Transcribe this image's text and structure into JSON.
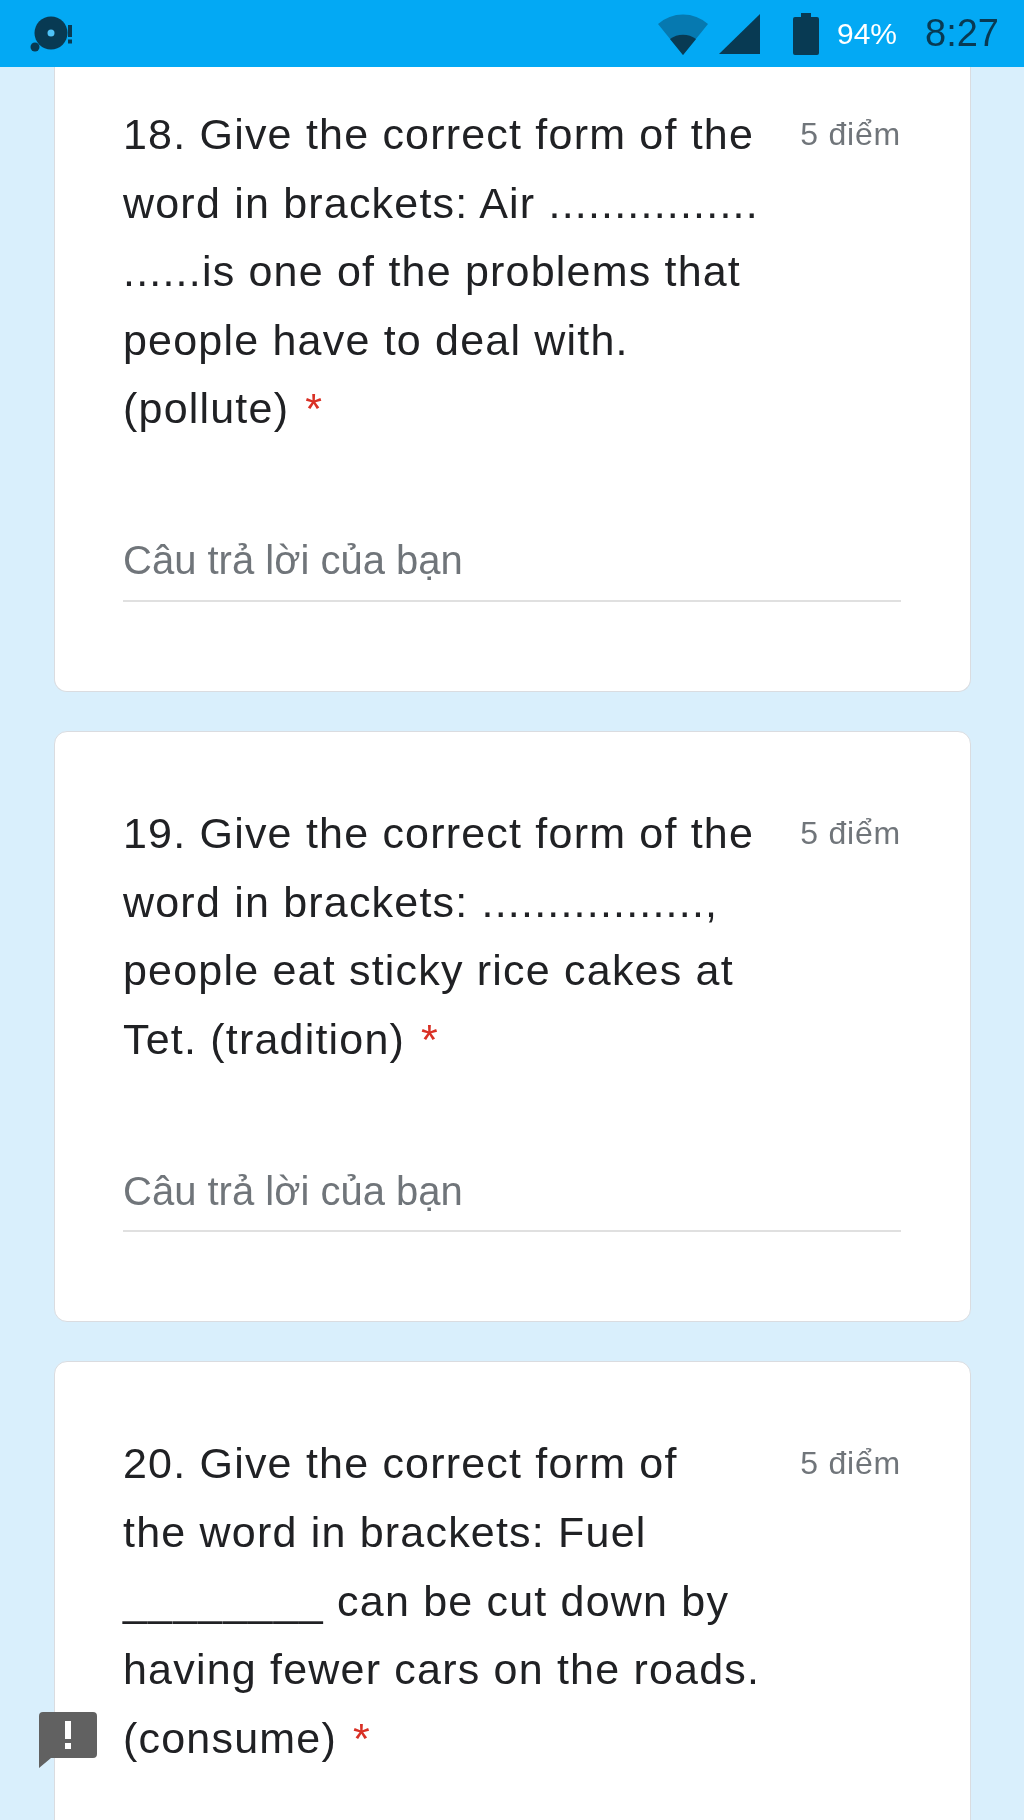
{
  "status_bar": {
    "battery_percent": "94%",
    "time": "8:27"
  },
  "questions": [
    {
      "title": "18. Give the correct form of the\nword in brackets: Air ................\n......is one of the problems that\npeople have to deal with.\n(pollute)",
      "required_mark": "*",
      "points": "5 điểm",
      "placeholder": "Câu trả lời của bạn"
    },
    {
      "title": "19. Give the correct form of the\nword in brackets: .................,\npeople eat sticky rice cakes at\nTet. (tradition)",
      "required_mark": "*",
      "points": "5 điểm",
      "placeholder": "Câu trả lời của bạn"
    },
    {
      "title": "20. Give the correct form of\nthe word in brackets: Fuel\n________ can be cut down by\nhaving fewer cars on the roads.\n(consume)",
      "required_mark": "*",
      "points": "5 điểm"
    }
  ]
}
